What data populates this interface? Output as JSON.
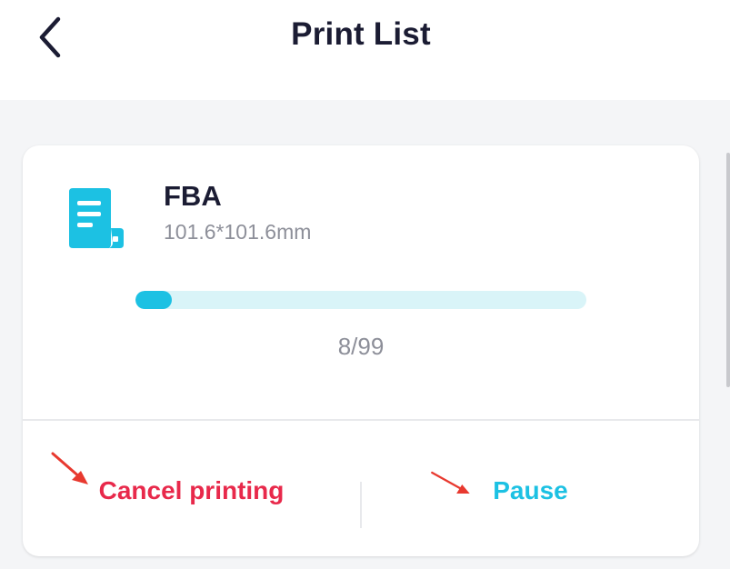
{
  "header": {
    "title": "Print List"
  },
  "job": {
    "name": "FBA",
    "size": "101.6*101.6mm",
    "progress_text": "8/99",
    "progress_current": 8,
    "progress_total": 99,
    "icon": "document-icon"
  },
  "actions": {
    "cancel_label": "Cancel printing",
    "pause_label": "Pause"
  },
  "colors": {
    "accent": "#1cc1e3",
    "danger": "#e8294b",
    "progress_track": "#d9f4f8",
    "title": "#1b1c33",
    "annotation_arrow": "#e8392f"
  }
}
